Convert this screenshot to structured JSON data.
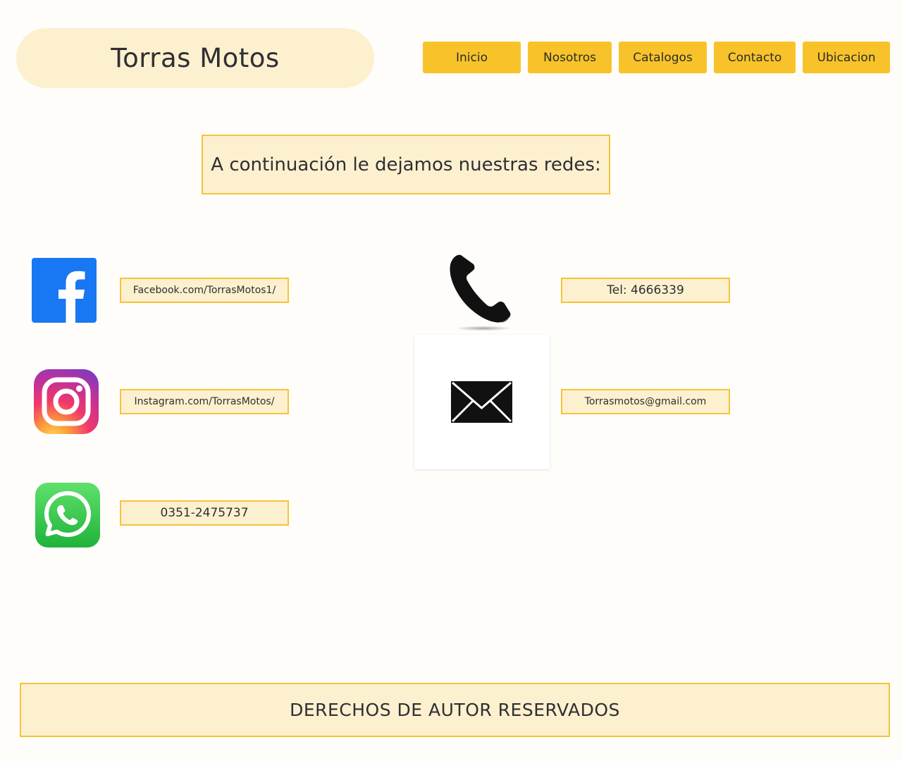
{
  "header": {
    "brand": "Torras Motos",
    "nav": [
      "Inicio",
      "Nosotros",
      "Catalogos",
      "Contacto",
      "Ubicacion"
    ]
  },
  "intro": {
    "text": "A continuación le dejamos nuestras redes:"
  },
  "contacts": {
    "facebook": "Facebook.com/TorrasMotos1/",
    "instagram": "Instagram.com/TorrasMotos/",
    "whatsapp": "0351-2475737",
    "phone": "Tel:  4666339",
    "email": "Torrasmotos@gmail.com"
  },
  "footer": {
    "text": "DERECHOS DE AUTOR RESERVADOS"
  },
  "colors": {
    "accent": "#f8c32a",
    "panel": "#fdf0cf",
    "facebook": "#1877f2",
    "whatsapp": "#25d366"
  },
  "icons": [
    "facebook-icon",
    "instagram-icon",
    "whatsapp-icon",
    "phone-icon",
    "mail-icon"
  ]
}
